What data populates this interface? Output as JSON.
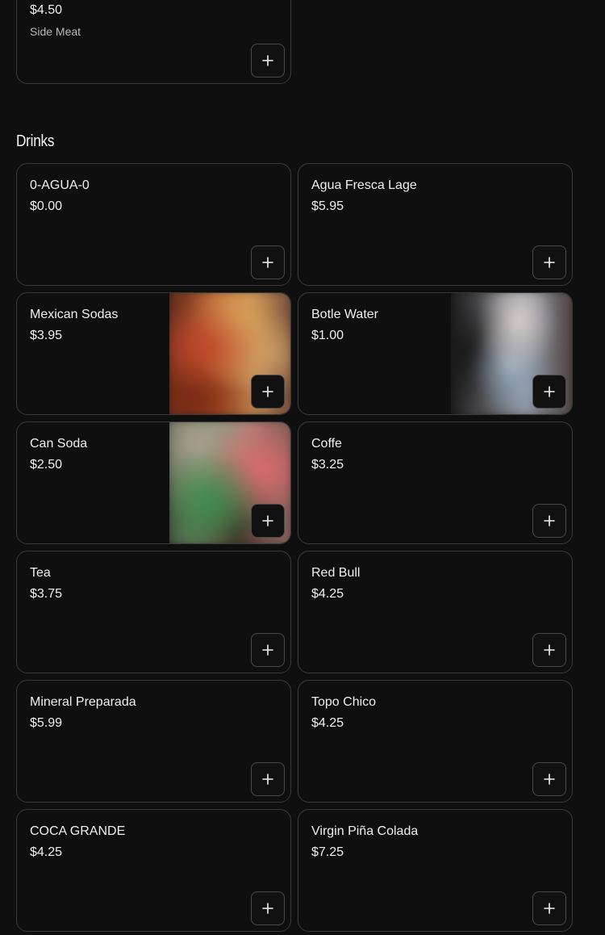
{
  "top_card": {
    "price": "$4.50",
    "description": "Side Meat"
  },
  "section": {
    "title": "Drinks"
  },
  "items": [
    {
      "name": "0-AGUA-0",
      "price": "$0.00"
    },
    {
      "name": "Agua Fresca Lage",
      "price": "$5.95"
    },
    {
      "name": "Mexican Sodas",
      "price": "$3.95",
      "has_photo": true
    },
    {
      "name": "Botle Water",
      "price": "$1.00",
      "has_photo": true
    },
    {
      "name": "Can Soda",
      "price": "$2.50",
      "has_photo": true
    },
    {
      "name": "Coffe",
      "price": "$3.25"
    },
    {
      "name": "Tea",
      "price": "$3.75"
    },
    {
      "name": "Red Bull",
      "price": "$4.25"
    },
    {
      "name": "Mineral Preparada",
      "price": "$5.99"
    },
    {
      "name": "Topo Chico",
      "price": "$4.25"
    },
    {
      "name": "COCA GRANDE",
      "price": "$4.25"
    },
    {
      "name": "Virgin Piña Colada",
      "price": "$7.25"
    }
  ],
  "icons": {
    "add": "plus-icon"
  },
  "colors": {
    "background": "#0f0f0f",
    "card_border": "#3a3a3a",
    "text": "#f0f0f0",
    "muted_text": "#b8b8b8"
  }
}
